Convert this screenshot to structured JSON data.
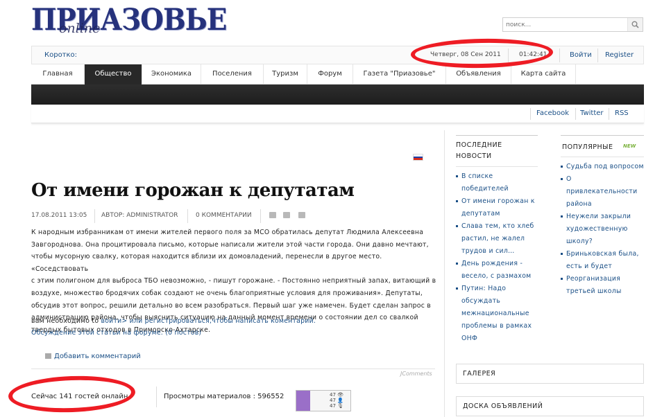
{
  "header": {
    "logo_main": "ПРИАЗОВЬЕ",
    "logo_sub": "online",
    "search_placeholder": "поиск..."
  },
  "topbar": {
    "short": "Коротко:",
    "date": "Четверг, 08 Сен 2011",
    "time": "01:42:41",
    "login": "Войти",
    "register": "Register"
  },
  "nav": {
    "items": [
      "Главная",
      "Общество",
      "Экономика",
      "Поселения",
      "Туризм",
      "Форум",
      "Газета \"Приазовье\"",
      "Объявления",
      "Карта сайта"
    ],
    "active_index": 1
  },
  "social": {
    "facebook": "Facebook",
    "twitter": "Twitter",
    "rss": "RSS"
  },
  "article": {
    "title": "От имени горожан к депутатам",
    "date": "17.08.2011 13:05",
    "author": "АВТОР: ADMINISTRATOR",
    "comments": "0 КОММЕНТАРИИ",
    "lines": [
      "К народным избранникам от имени жителей первого поля за МСО обратилась депутат Людмила Алексеевна",
      "Завгороднова. Она процитировала письмо, которые написали жители этой части города. Они давно мечтают,",
      "чтобы мусорную свалку, которая находится вблизи их домовладений, перенесли в другое место. «Соседствовать",
      "с этим полигоном для выброса ТБО невозможно, - пишут горожане. - Постоянно неприятный запах, витающий в",
      "воздухе, множество бродячих собак создают не очень благоприятные условия для проживания». Депутаты,",
      "обсудив этот вопрос, решили детально во всем разобраться. Первый шаг уже намечен. Будет сделан запрос в",
      "администрацию района, чтобы выяснить ситуацию на данный момент времени о состоянии дел со свалкой",
      "твердых бытовых отходов в Приморско-Ахтарске."
    ],
    "register_prefix": "вам необходимо to",
    "register_link": "войти> или регистрироваться,чтобы написать коментарий.",
    "forum_link": "Обсуждение этой статьи на форуме. (0 постов)",
    "add_comment": "Добавить комментарий",
    "comments_tag": "JComments"
  },
  "footer": {
    "online": "Сейчас 141 гостей онлайн",
    "views": "Просмотры материалов : 596552",
    "counter_lines": [
      "47 👁",
      "47 👤",
      "47 🎙"
    ]
  },
  "latest_news": {
    "title_line1": "ПОСЛЕДНИЕ",
    "title_line2": "НОВОСТИ",
    "items": [
      [
        "В списке",
        "победителей"
      ],
      [
        "От имени горожан к",
        "депутатам"
      ],
      [
        "Слава тем, кто хлеб",
        "растил, не жалел",
        "трудов и сил…"
      ],
      [
        "День рождения -",
        "весело, с размахом"
      ],
      [
        "Путин: Надо",
        "обсуждать",
        "межнациональные",
        "проблемы в рамках",
        "ОНФ"
      ]
    ]
  },
  "popular": {
    "title": "ПОПУЛЯРНЫЕ",
    "badge": "NEW",
    "items": [
      [
        "Судьба под вопросом"
      ],
      [
        "О привлекательности",
        "района"
      ],
      [
        "Неужели закрыли",
        "художественную",
        "школу?"
      ],
      [
        "Бриньковская была,",
        "есть и будет"
      ],
      [
        "Реорганизация",
        "третьей школы"
      ]
    ]
  },
  "boxes": {
    "gallery": "ГАЛЕРЕЯ",
    "board": "ДОСКА ОБЪЯВЛЕНИЙ"
  },
  "colors": {
    "link": "#1a4f86",
    "nav_active": "#282828",
    "marker": "#ee1c24"
  }
}
